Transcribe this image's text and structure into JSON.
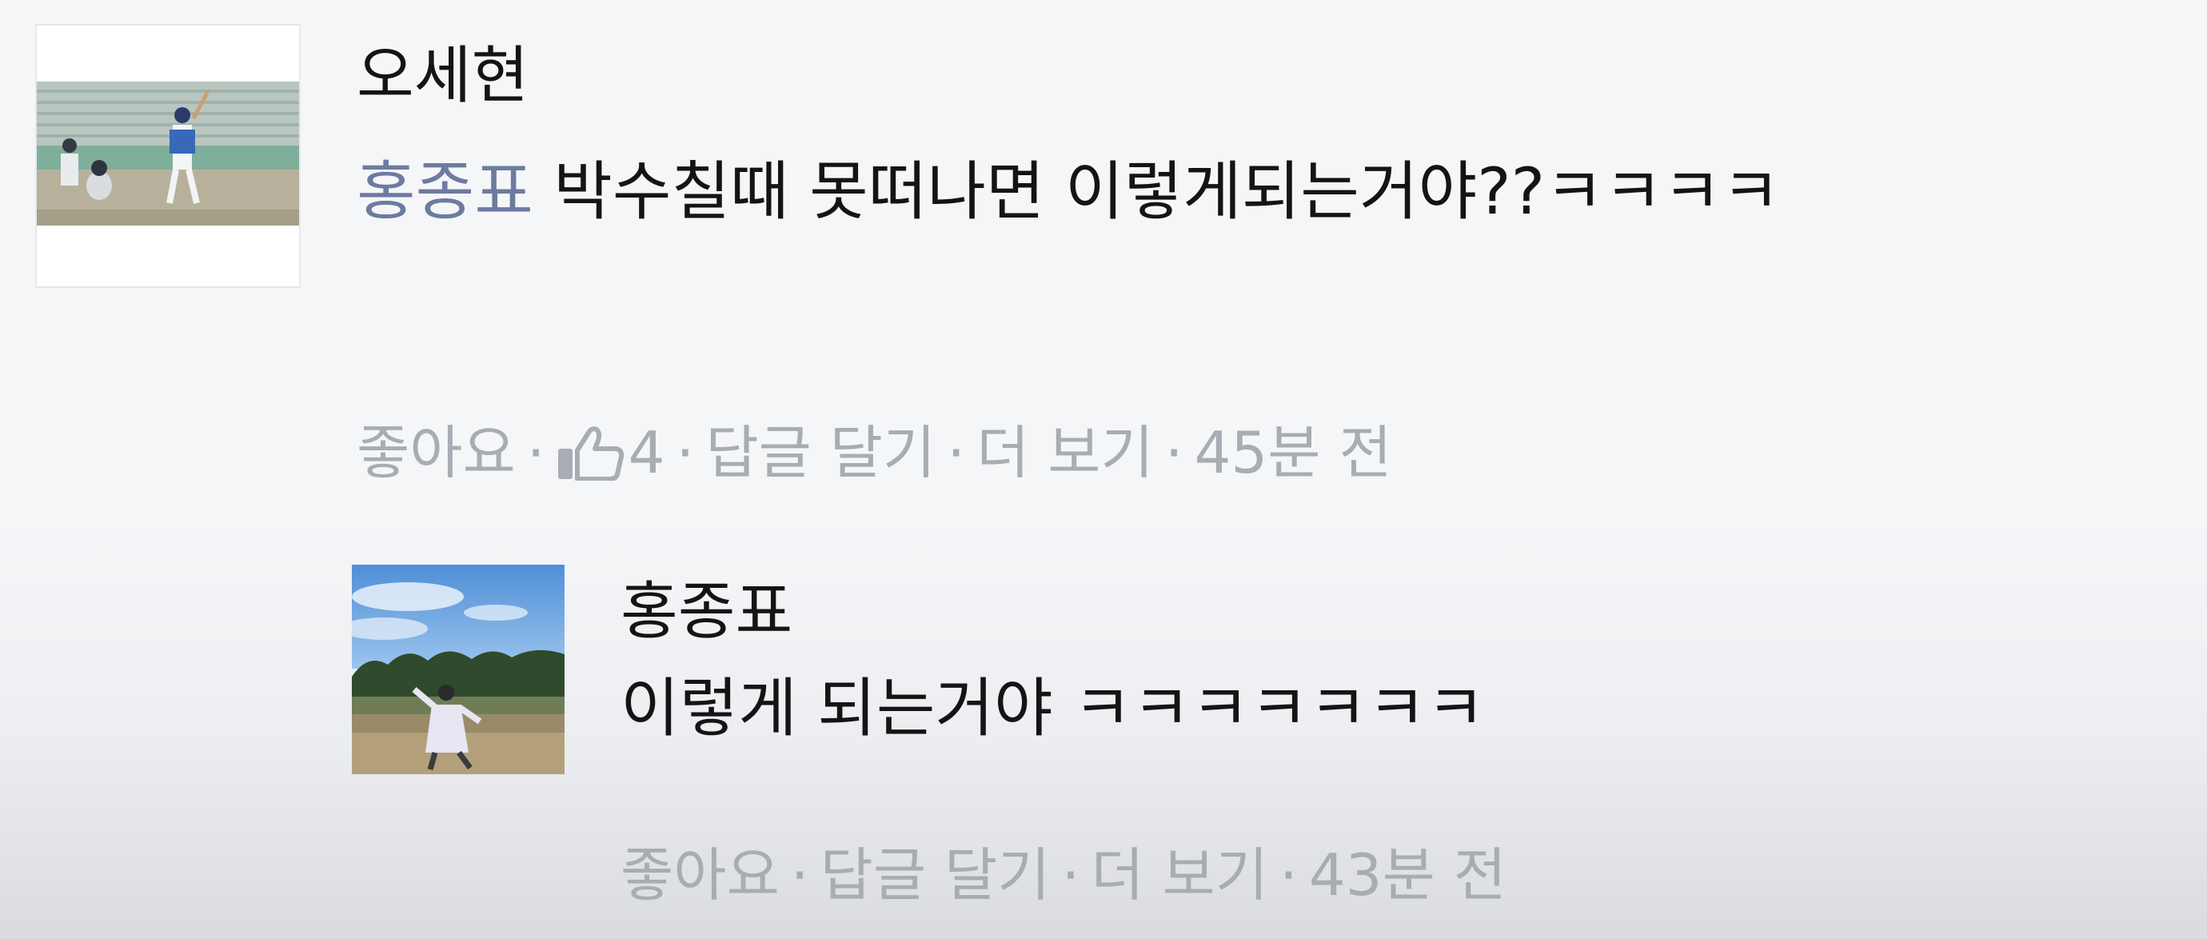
{
  "comments": [
    {
      "author": "오세현",
      "mention": "홍종표",
      "text": "박수칠때 못떠나면 이렇게되는거야??ㅋㅋㅋㅋ",
      "actions": {
        "like_label": "좋아요",
        "like_count": "4",
        "reply_label": "답글 달기",
        "more_label": "더 보기",
        "time": "45분 전",
        "separator": "·"
      },
      "avatar_icon": "baseball-batter-photo"
    },
    {
      "author": "홍종표",
      "text": "이렇게 되는거야 ㅋㅋㅋㅋㅋㅋㅋ",
      "actions": {
        "like_label": "좋아요",
        "reply_label": "답글 달기",
        "more_label": "더 보기",
        "time": "43분 전",
        "separator": "·"
      },
      "avatar_icon": "field-pitcher-photo"
    }
  ],
  "colors": {
    "text": "#141414",
    "mention": "#6d7ba0",
    "meta": "#a8acb3",
    "background": "#f5f6f8"
  },
  "icons": {
    "like": "thumbs-up-icon"
  }
}
